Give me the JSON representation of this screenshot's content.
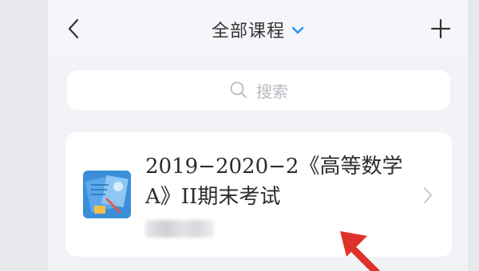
{
  "header": {
    "title": "全部课程",
    "back_icon": "chevron-left-icon",
    "dropdown_icon": "chevron-down-icon",
    "add_icon": "plus-icon"
  },
  "search": {
    "placeholder": "搜索",
    "icon": "search-icon"
  },
  "course": {
    "title": "2019−2020−2《高等数学A》II期末考试",
    "cover_icon": "course-cover-image",
    "arrow_icon": "chevron-right-icon"
  },
  "annotation": {
    "icon": "red-arrow-pointer"
  },
  "colors": {
    "accent": "#2b8ef0",
    "pointer": "#e0302b",
    "cover_blue": "#3a8fd8"
  }
}
